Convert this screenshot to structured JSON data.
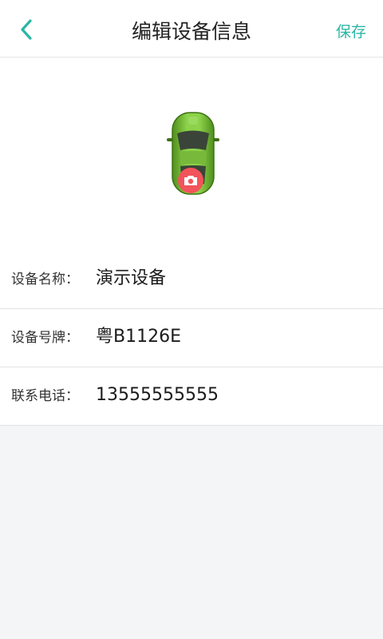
{
  "header": {
    "title": "编辑设备信息",
    "save_label": "保存",
    "back_icon": "chevron-left-icon",
    "accent_color": "#2ab6a6"
  },
  "avatar": {
    "image": "green-car-icon",
    "badge_icon": "camera-icon",
    "badge_color": "#f2545b"
  },
  "form": {
    "rows": [
      {
        "label": "设备名称：",
        "value": "演示设备"
      },
      {
        "label": "设备号牌：",
        "value": "粤B1126E"
      },
      {
        "label": "联系电话：",
        "value": "13555555555"
      }
    ]
  }
}
